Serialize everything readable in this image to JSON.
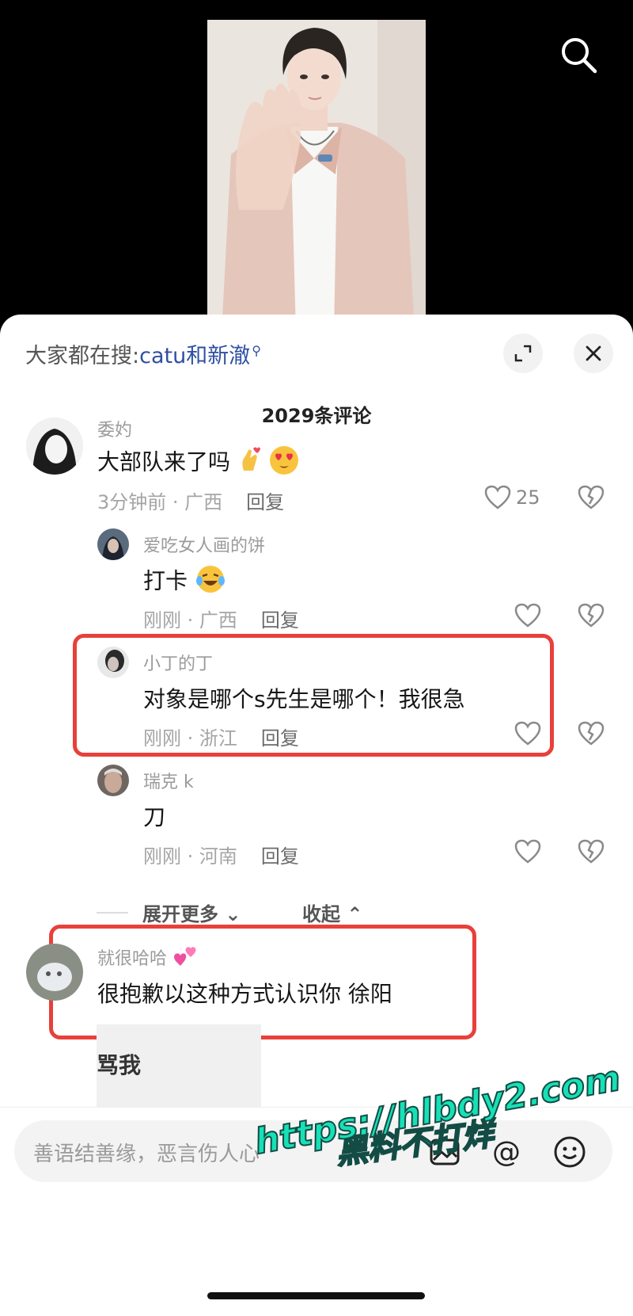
{
  "trending": {
    "prefix": "大家都在搜:",
    "keyword": "catu和新澈"
  },
  "comment_count": "2029条评论",
  "comments": [
    {
      "author": "委妁",
      "text": "大部队来了吗",
      "time_location": "3分钟前 · 广西",
      "reply": "回复",
      "likes": "25"
    },
    {
      "author": "爱吃女人画的饼",
      "text": "打卡",
      "time_location": "刚刚 · 广西",
      "reply": "回复"
    },
    {
      "author": "小丁的丁",
      "text": "对象是哪个s先生是哪个！我很急",
      "time_location": "刚刚 · 浙江",
      "reply": "回复"
    },
    {
      "author": "瑞克 k",
      "text": "刀",
      "time_location": "刚刚 · 河南",
      "reply": "回复"
    },
    {
      "author": "就很哈哈",
      "text": "很抱歉以这种方式认识你 徐阳"
    }
  ],
  "thread": {
    "expand": "展开更多",
    "collapse": "收起"
  },
  "sticker_text": "骂我",
  "input": {
    "placeholder": "善语结善缘，恶言伤人心"
  },
  "watermark": {
    "line1": "黑料不打烊",
    "line2": "https://hlbdy2.com"
  },
  "colors": {
    "highlight_box": "#e8403b",
    "keyword": "#2f4fa3",
    "watermark": "#17e0b7"
  }
}
